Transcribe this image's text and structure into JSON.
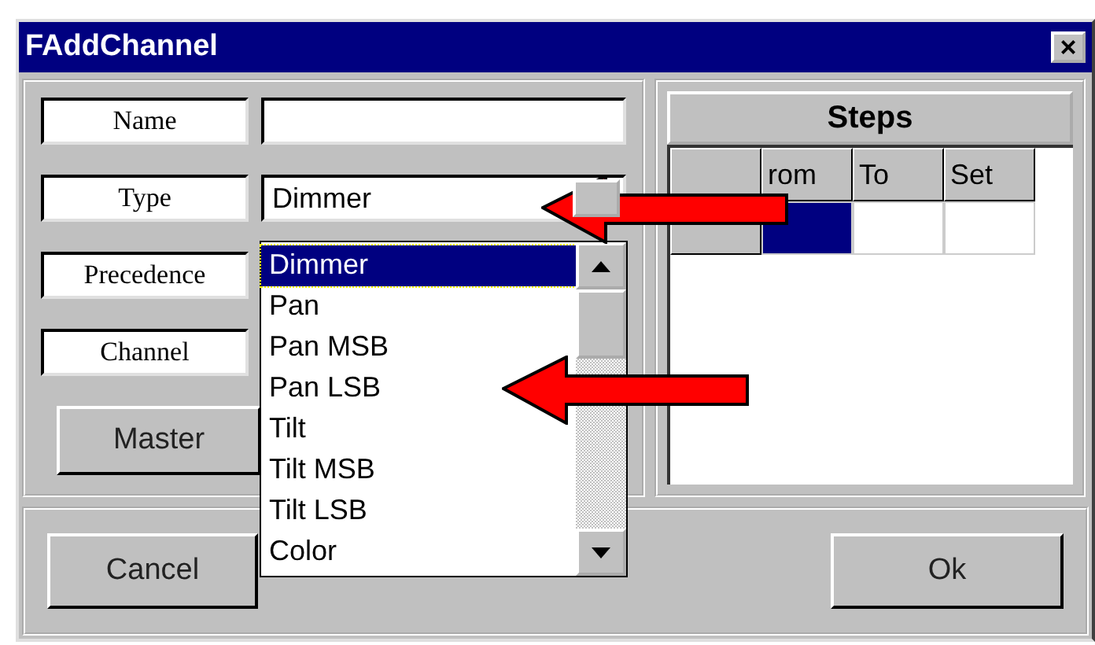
{
  "window": {
    "title": "FAddChannel",
    "close": "×"
  },
  "fields": [
    {
      "label": "Name",
      "kind": "text"
    },
    {
      "label": "Type",
      "kind": "combo",
      "value": "Dimmer"
    },
    {
      "label": "Precedence"
    },
    {
      "label": "Channel"
    }
  ],
  "master_button": "Master",
  "dropdown": {
    "items": [
      {
        "label": "Dimmer",
        "selected": true
      },
      {
        "label": "Pan",
        "selected": false
      },
      {
        "label": "Pan MSB",
        "selected": false
      },
      {
        "label": "Pan LSB",
        "selected": false
      },
      {
        "label": "Tilt",
        "selected": false
      },
      {
        "label": "Tilt MSB",
        "selected": false
      },
      {
        "label": "Tilt LSB",
        "selected": false
      },
      {
        "label": "Color",
        "selected": false
      }
    ]
  },
  "steps": {
    "title": "Steps",
    "columns": [
      "",
      "rom",
      "To",
      "Set"
    ],
    "rows": [
      [
        {
          "selected": true
        },
        {
          "selected": false
        },
        {
          "selected": false
        }
      ]
    ]
  },
  "buttons": {
    "cancel": "Cancel",
    "ok": "Ok"
  }
}
